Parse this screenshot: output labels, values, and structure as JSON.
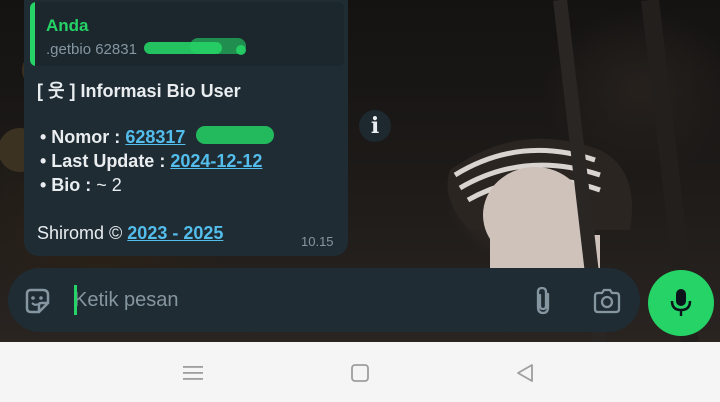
{
  "quoted": {
    "author": "Anda",
    "text": ".getbio 62831"
  },
  "message": {
    "heading": "[ 웃 ] Informasi Bio User",
    "nomor_label": "• Nomor : ",
    "nomor_value": "628317",
    "update_label": "• Last Update : ",
    "update_value": "2024-12-12",
    "bio_label": "• Bio : ",
    "bio_value": "~ 2",
    "footer_prefix": "Shiromd © ",
    "footer_link": "2023 - 2025",
    "time": "10.15"
  },
  "input": {
    "placeholder": "Ketik pesan"
  },
  "icons": {
    "sticker": "sticker-icon",
    "attach": "paperclip-icon",
    "camera": "camera-icon",
    "mic": "microphone-icon",
    "info": "info-icon",
    "nav_menu": "menu-icon",
    "nav_home": "home-icon",
    "nav_back": "back-icon"
  },
  "colors": {
    "accent": "#25d366",
    "link": "#53bdeb",
    "bubble": "#1f2c34"
  }
}
